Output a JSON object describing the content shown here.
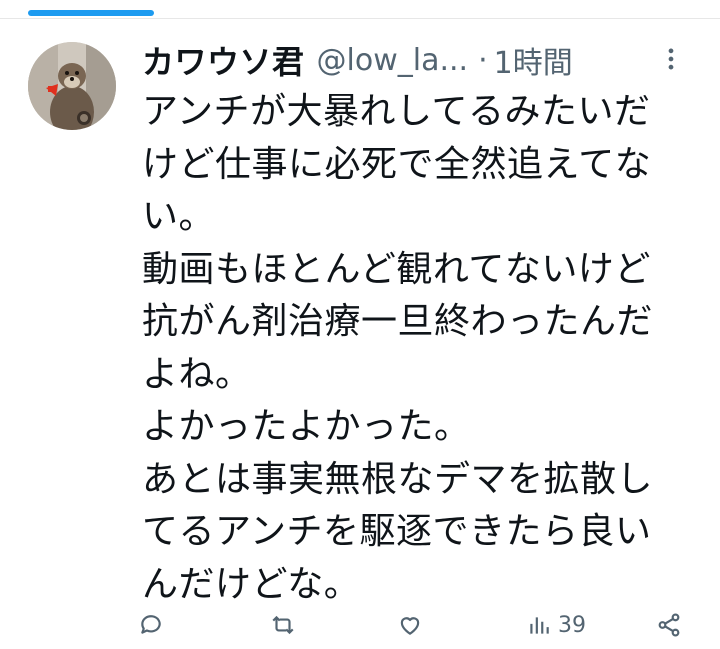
{
  "tweet": {
    "author": {
      "display_name": "カワウソ君",
      "handle": "@low_la...",
      "avatar_icon": "otter-avatar"
    },
    "separator": "·",
    "time": "1時間",
    "body_lines": [
      "アンチが大暴れしてるみたいだ",
      "けど仕事に必死で全然追えてな",
      "い。",
      "動画もほとんど観れてないけど",
      "抗がん剤治療一旦終わったんだ",
      "よね。",
      "よかったよかった。",
      "あとは事実無根なデマを拡散し",
      "てるアンチを駆逐できたら良い",
      "んだけどな。"
    ],
    "actions": {
      "reply_icon": "reply-icon",
      "retweet_icon": "retweet-icon",
      "like_icon": "heart-icon",
      "views_icon": "views-icon",
      "views_count": "39",
      "share_icon": "share-icon"
    }
  },
  "colors": {
    "accent": "#1d9bf0",
    "text": "#0f1419",
    "secondary": "#536471"
  }
}
